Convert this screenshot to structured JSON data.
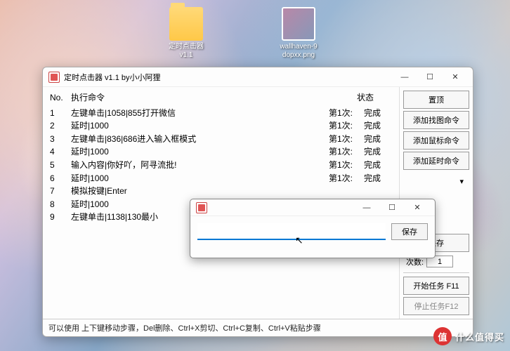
{
  "desktop": {
    "icons": [
      {
        "name": "folder",
        "label": "定时点击器\nv1.1"
      },
      {
        "name": "image",
        "label": "wallhaven-9\ndopxx.png"
      }
    ]
  },
  "mainWindow": {
    "title": "定时点击器 v1.1 by小小阿狸",
    "columns": {
      "no": "No.",
      "cmd": "执行命令",
      "state": "状态"
    },
    "rows": [
      {
        "no": "1",
        "cmd": "左键单击|1058|855打开微信",
        "cnt": "第1次:",
        "st": "完成"
      },
      {
        "no": "2",
        "cmd": "延时|1000",
        "cnt": "第1次:",
        "st": "完成"
      },
      {
        "no": "3",
        "cmd": "左键单击|836|686进入输入框模式",
        "cnt": "第1次:",
        "st": "完成"
      },
      {
        "no": "4",
        "cmd": "延时|1000",
        "cnt": "第1次:",
        "st": "完成"
      },
      {
        "no": "5",
        "cmd": "输入内容|你好吖，阿寻流批!",
        "cnt": "第1次:",
        "st": "完成"
      },
      {
        "no": "6",
        "cmd": "延时|1000",
        "cnt": "第1次:",
        "st": "完成"
      },
      {
        "no": "7",
        "cmd": "模拟按键|Enter",
        "cnt": "",
        "st": ""
      },
      {
        "no": "8",
        "cmd": "延时|1000",
        "cnt": "",
        "st": ""
      },
      {
        "no": "9",
        "cmd": "左键单击|1138|130最小",
        "cnt": "",
        "st": ""
      }
    ],
    "sidebar": {
      "top": "置顶",
      "addImg": "添加找图命令",
      "addMouse": "添加鼠标命令",
      "addDelay": "添加延时命令",
      "dropdown": "▾",
      "save": "保存",
      "countLabel": "次数:",
      "countValue": "1",
      "start": "开始任务 F11",
      "stop": "停止任务F12"
    },
    "footer": "可以使用 上下键移动步骤，Del删除、Ctrl+X剪切、Ctrl+C复制、Ctrl+V粘贴步骤"
  },
  "dialog": {
    "value": "",
    "saveBtn": "保存"
  },
  "watermark": {
    "badge": "值",
    "text": "什么值得买"
  },
  "winCtrl": {
    "min": "—",
    "max": "☐",
    "close": "✕"
  }
}
